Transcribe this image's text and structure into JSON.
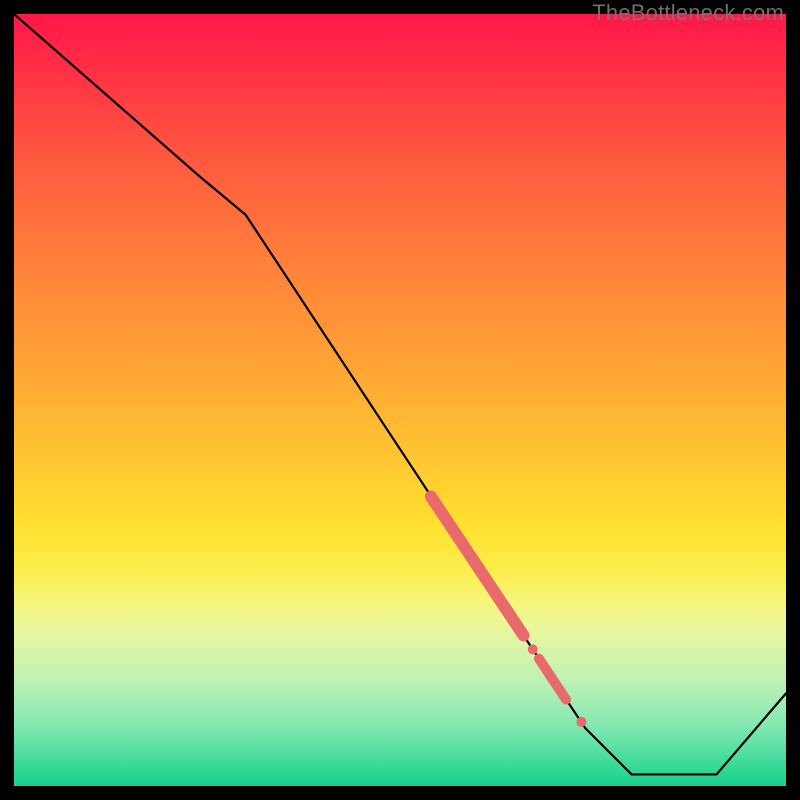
{
  "watermark": "TheBottleneck.com",
  "chart_data": {
    "type": "line",
    "title": "",
    "xlabel": "",
    "ylabel": "",
    "xlim": [
      0,
      100
    ],
    "ylim": [
      0,
      100
    ],
    "grid": false,
    "legend": false,
    "series": [
      {
        "name": "bottleneck-curve",
        "color": "#000000",
        "x": [
          0,
          24,
          30,
          58,
          60,
          62,
          67,
          69,
          71,
          74,
          80,
          91,
          100
        ],
        "values": [
          100,
          79,
          74,
          31.5,
          28.5,
          25.5,
          18,
          15,
          12,
          7.5,
          1.5,
          1.5,
          12
        ]
      }
    ],
    "highlights": [
      {
        "name": "thick-segment-1",
        "color": "#e86a6a",
        "width": 12,
        "x": [
          54,
          66
        ],
        "values": [
          37.5,
          19.5
        ]
      },
      {
        "name": "dot-1",
        "color": "#e86a6a",
        "radius": 5,
        "x": 67.2,
        "value": 17.7
      },
      {
        "name": "thick-segment-2",
        "color": "#e86a6a",
        "width": 10,
        "x": [
          68,
          71.5
        ],
        "values": [
          16.5,
          11.2
        ]
      },
      {
        "name": "dot-2",
        "color": "#e86a6a",
        "radius": 5,
        "x": 73.5,
        "value": 8.3
      }
    ]
  }
}
